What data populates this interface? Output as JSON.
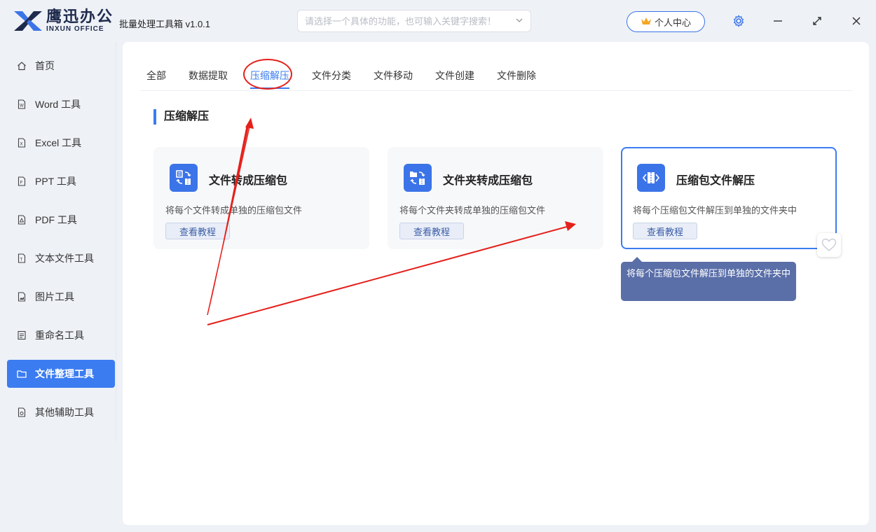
{
  "app": {
    "logo_cn": "鹰迅办公",
    "logo_en": "INXUN OFFICE",
    "title": "批量处理工具箱 v1.0.1",
    "brand_color": "#3b7cf0"
  },
  "search": {
    "placeholder": "请选择一个具体的功能，也可输入关键字搜索！"
  },
  "header": {
    "user_center": "个人中心"
  },
  "sidebar": {
    "items": [
      {
        "label": "首页",
        "icon": "home-icon"
      },
      {
        "label": "Word 工具",
        "icon": "word-file-icon"
      },
      {
        "label": "Excel 工具",
        "icon": "excel-file-icon"
      },
      {
        "label": "PPT 工具",
        "icon": "ppt-file-icon"
      },
      {
        "label": "PDF 工具",
        "icon": "pdf-file-icon"
      },
      {
        "label": "文本文件工具",
        "icon": "text-file-icon"
      },
      {
        "label": "图片工具",
        "icon": "image-file-icon"
      },
      {
        "label": "重命名工具",
        "icon": "rename-icon"
      },
      {
        "label": "文件整理工具",
        "icon": "folder-icon",
        "active": true
      },
      {
        "label": "其他辅助工具",
        "icon": "tools-icon"
      }
    ]
  },
  "tabs": [
    "全部",
    "数据提取",
    "压缩解压",
    "文件分类",
    "文件移动",
    "文件创建",
    "文件删除"
  ],
  "active_tab": "压缩解压",
  "section": {
    "title": "压缩解压"
  },
  "cards": [
    {
      "title": "文件转成压缩包",
      "desc": "将每个文件转成单独的压缩包文件",
      "button": "查看教程",
      "icon": "file-to-zip-icon"
    },
    {
      "title": "文件夹转成压缩包",
      "desc": "将每个文件夹转成单独的压缩包文件",
      "button": "查看教程",
      "icon": "folder-to-zip-icon"
    },
    {
      "title": "压缩包文件解压",
      "desc": "将每个压缩包文件解压到单独的文件夹中",
      "button": "查看教程",
      "icon": "unzip-icon"
    }
  ],
  "tooltip": {
    "text": "将每个压缩包文件解压到单独的文件夹中"
  }
}
